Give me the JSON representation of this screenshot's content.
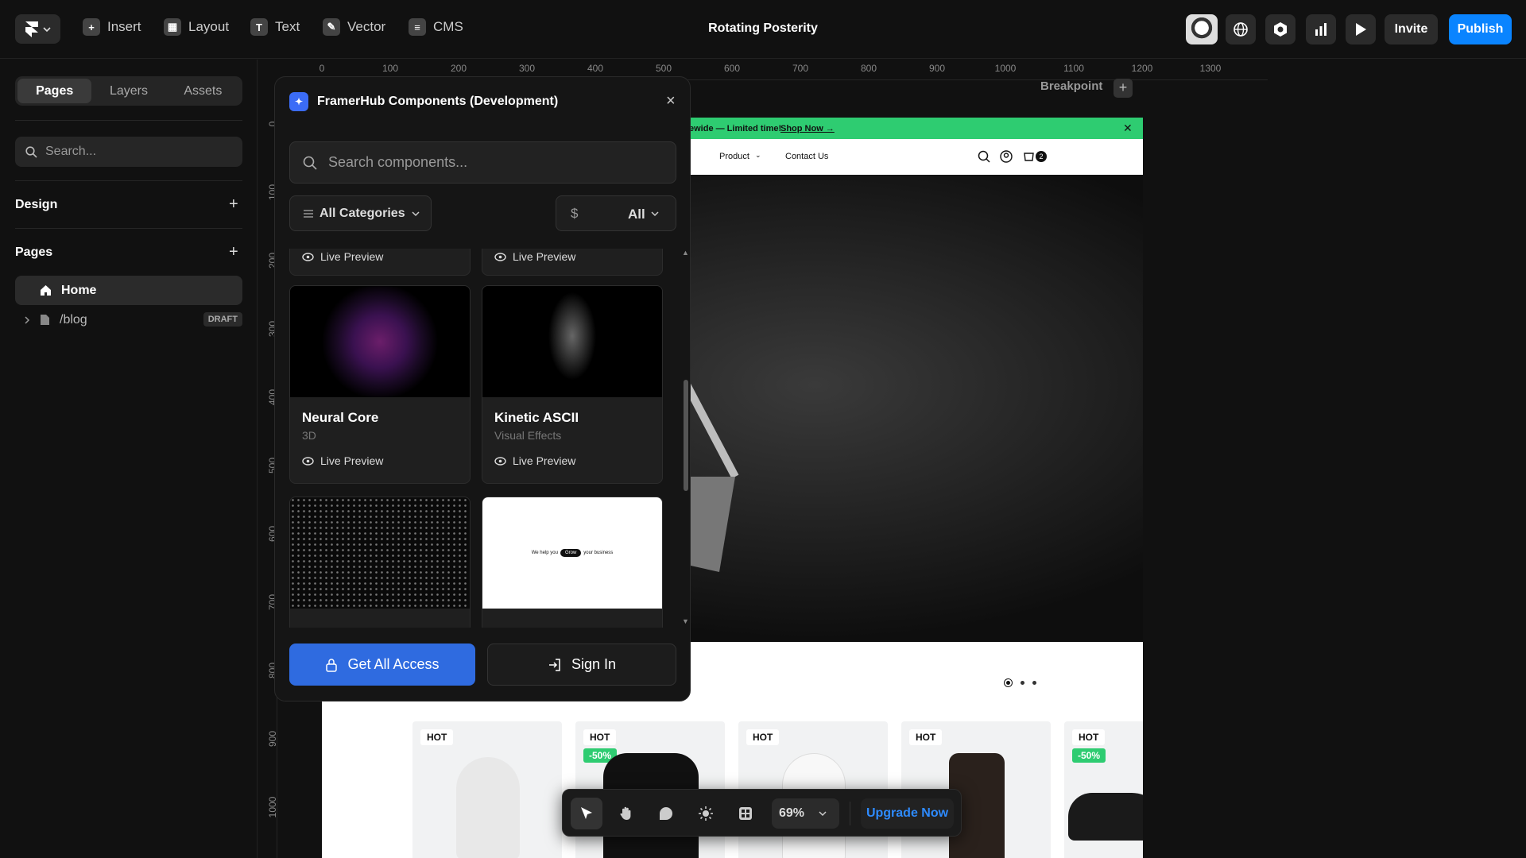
{
  "topbar": {
    "project_title": "Rotating Posterity",
    "tools": [
      "Insert",
      "Layout",
      "Text",
      "Vector",
      "CMS"
    ],
    "invite_label": "Invite",
    "publish_label": "Publish",
    "publish_color": "#0a84ff"
  },
  "sidebar": {
    "tabs": [
      "Pages",
      "Layers",
      "Assets"
    ],
    "search_placeholder": "Search...",
    "design_label": "Design",
    "pages_label": "Pages",
    "pages": [
      {
        "label": "Home",
        "icon": "home-icon"
      },
      {
        "label": "/blog",
        "icon": "file-icon",
        "badge": "DRAFT"
      }
    ]
  },
  "canvas": {
    "ruler_h": [
      "0",
      "100",
      "200",
      "300",
      "400",
      "500",
      "600",
      "700",
      "800",
      "900",
      "1000",
      "1100",
      "1200",
      "1300"
    ],
    "ruler_v": [
      "0",
      "100",
      "200",
      "300",
      "400",
      "500",
      "600",
      "700",
      "800",
      "900",
      "1000"
    ],
    "breakpoint_label": "Breakpoint"
  },
  "site": {
    "banner_text": "ewide — Limited time!",
    "banner_link": "Shop Now →",
    "nav_items": [
      "Product",
      "Contact Us"
    ],
    "cart_count": "2",
    "products": [
      {
        "hot": "HOT",
        "sale": ""
      },
      {
        "hot": "HOT",
        "sale": "-50%"
      },
      {
        "hot": "HOT",
        "sale": ""
      },
      {
        "hot": "HOT",
        "sale": ""
      },
      {
        "hot": "HOT",
        "sale": "-50%"
      }
    ]
  },
  "panel": {
    "title": "FramerHub Components (Development)",
    "search_placeholder": "Search components...",
    "category_label": "All Categories",
    "price_symbol": "$",
    "price_value": "All",
    "live_preview": "Live Preview",
    "cards": [
      {
        "name": "Neural Core",
        "category": "3D"
      },
      {
        "name": "Kinetic ASCII",
        "category": "Visual Effects"
      }
    ],
    "text_rotate_preview": {
      "before": "We help you",
      "pill": "Grow",
      "after": "your business"
    },
    "get_access_label": "Get All Access",
    "sign_in_label": "Sign In",
    "accent_color": "#2f6be0"
  },
  "bottombar": {
    "zoom": "69%",
    "upgrade_label": "Upgrade Now"
  }
}
